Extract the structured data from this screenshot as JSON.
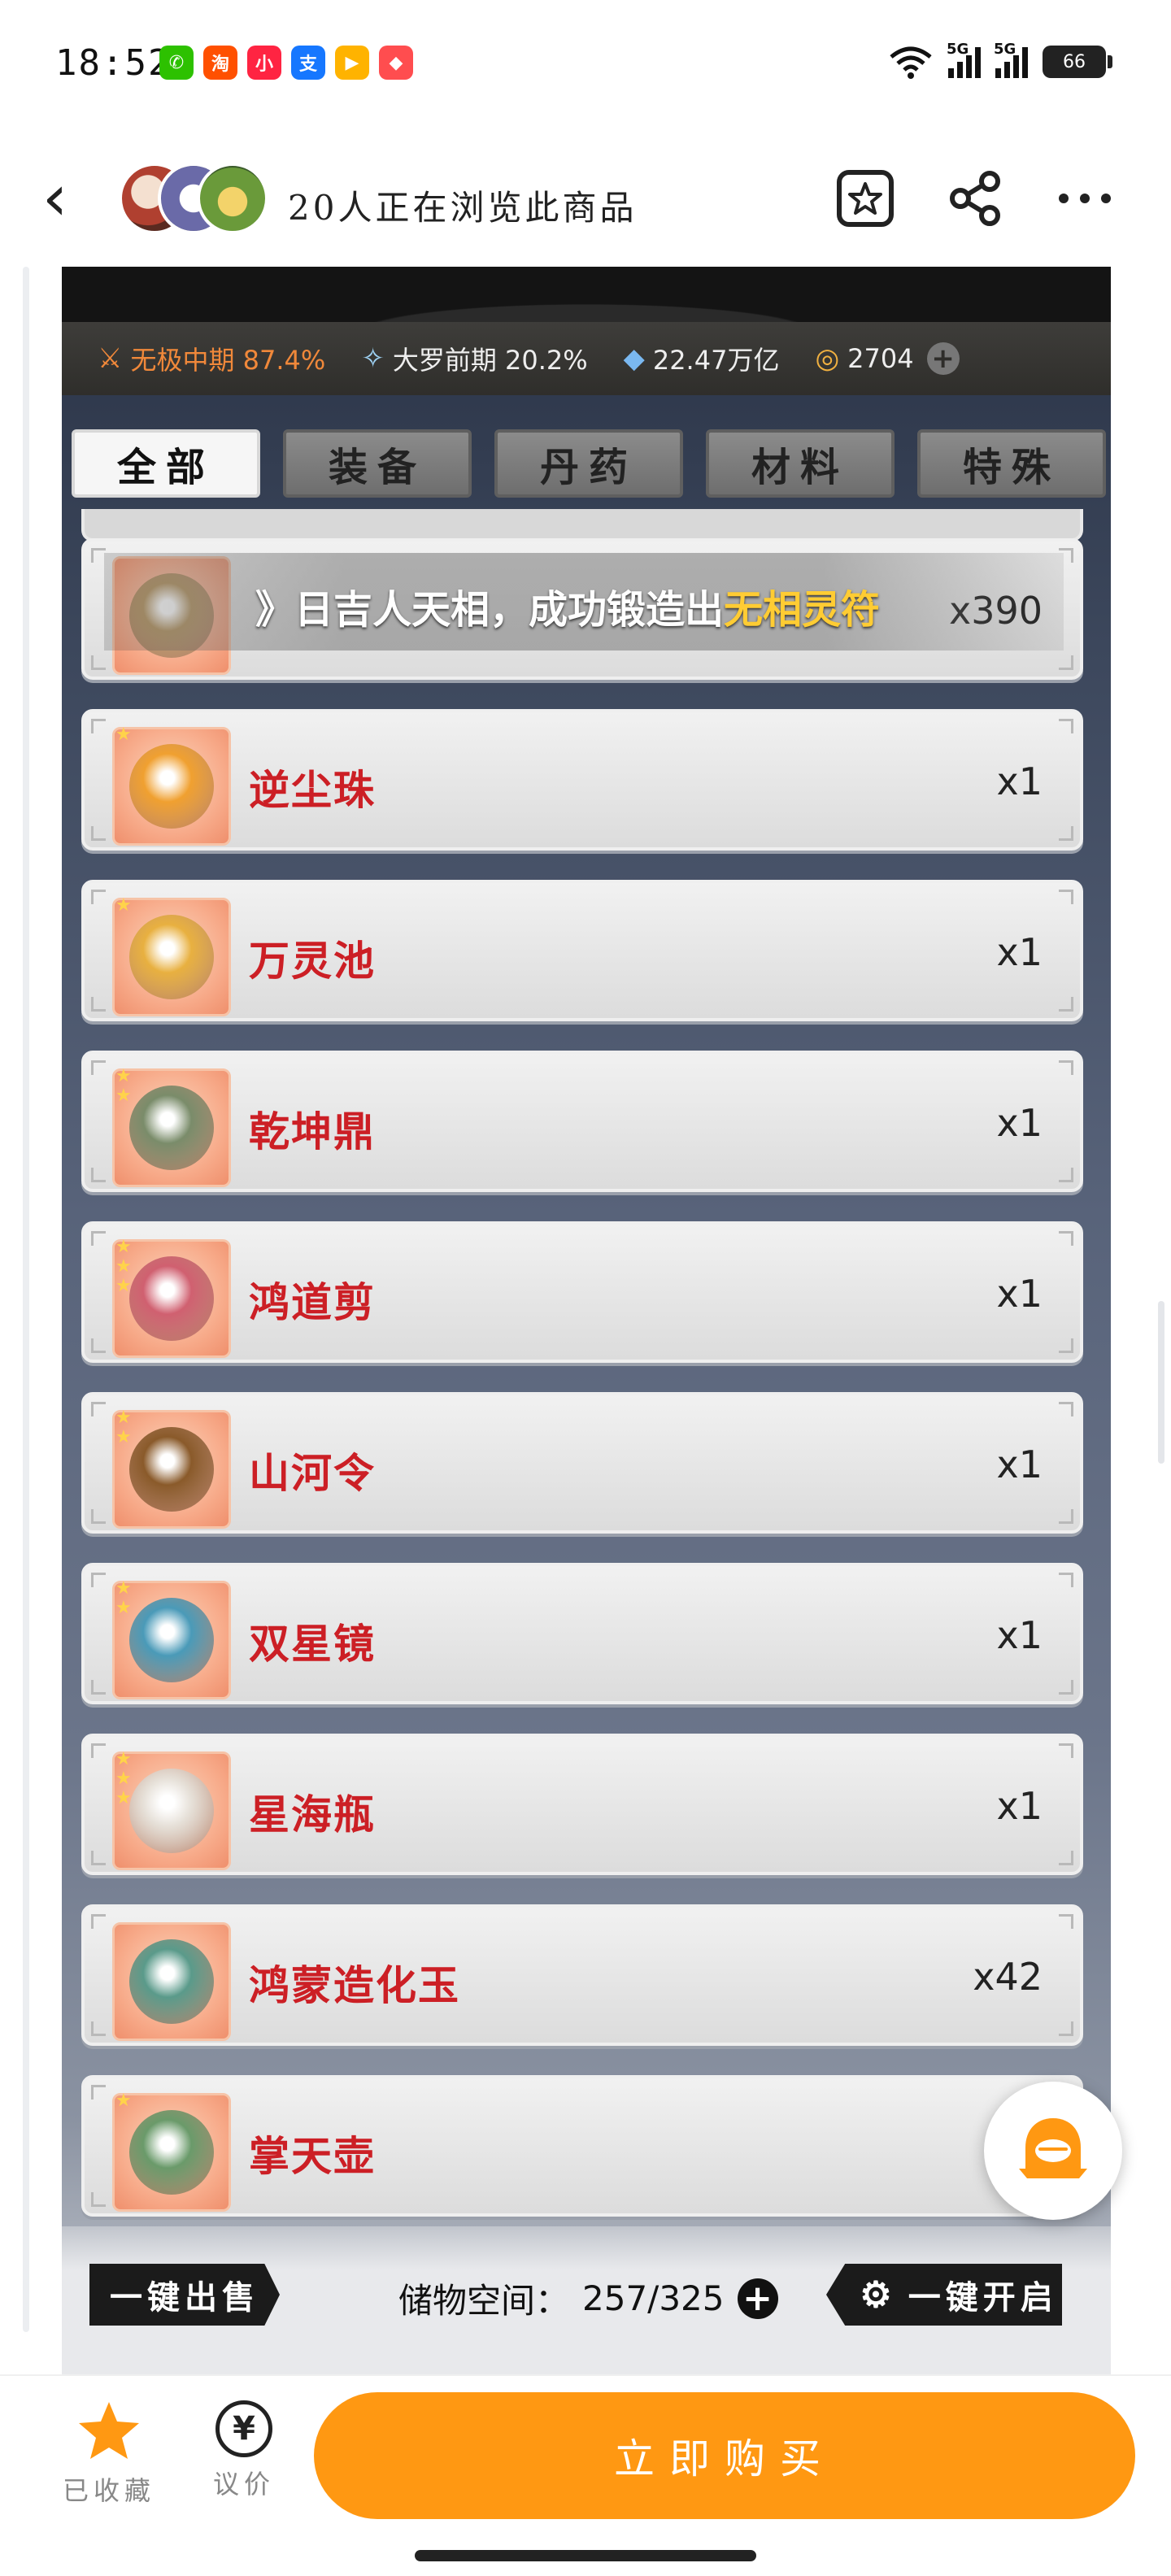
{
  "status_bar": {
    "time": "18:52",
    "apps": [
      {
        "icon": "wechat-icon",
        "color": "#2dc100",
        "glyph": "✆"
      },
      {
        "icon": "taobao-icon",
        "color": "#ff5000",
        "glyph": "淘"
      },
      {
        "icon": "xiaohongshu-icon",
        "color": "#ff2442",
        "glyph": "小"
      },
      {
        "icon": "alipay-icon",
        "color": "#1677ff",
        "glyph": "支"
      },
      {
        "icon": "video-icon",
        "color": "#ffb300",
        "glyph": "▶"
      },
      {
        "icon": "game-icon",
        "color": "#ff4d4f",
        "glyph": "◆"
      }
    ],
    "signal1": "5G",
    "signal2": "5G",
    "battery": "66"
  },
  "nav": {
    "title": "20人正在浏览此商品"
  },
  "game": {
    "stats": [
      {
        "icon": "sword-icon",
        "text": "无极中期 87.4%",
        "orange": true
      },
      {
        "icon": "fan-icon",
        "text": "大罗前期 20.2%",
        "orange": false
      },
      {
        "icon": "water-drop-icon",
        "text": "22.47万亿",
        "orange": false
      },
      {
        "icon": "coin-icon",
        "text": "2704",
        "orange": false
      }
    ],
    "tabs": [
      "全部",
      "装备",
      "丹药",
      "材料",
      "特殊"
    ],
    "active_tab": 0,
    "ticker": {
      "prefix": "》日吉人天相，成功锻造出",
      "highlight": "无相灵符"
    },
    "items": [
      {
        "name": "",
        "qty": "x390",
        "stars": 0,
        "art": "#b89a6a"
      },
      {
        "name": "逆尘珠",
        "qty": "x1",
        "stars": 1,
        "art": "#f0a030"
      },
      {
        "name": "万灵池",
        "qty": "x1",
        "stars": 1,
        "art": "#e8b040"
      },
      {
        "name": "乾坤鼎",
        "qty": "x1",
        "stars": 2,
        "art": "#7a8c6a"
      },
      {
        "name": "鸿道剪",
        "qty": "x1",
        "stars": 3,
        "art": "#d06070"
      },
      {
        "name": "山河令",
        "qty": "x1",
        "stars": 2,
        "art": "#8a5a2a"
      },
      {
        "name": "双星镜",
        "qty": "x1",
        "stars": 2,
        "art": "#4a9ab8"
      },
      {
        "name": "星海瓶",
        "qty": "x1",
        "stars": 3,
        "art": "#e6e0d8"
      },
      {
        "name": "鸿蒙造化玉",
        "qty": "x42",
        "stars": 0,
        "art": "#5a9a8a"
      },
      {
        "name": "掌天壶",
        "qty": "",
        "stars": 1,
        "art": "#6a9a6a"
      }
    ],
    "sell_all_label": "一键出售",
    "storage_label": "储物空间：",
    "storage_value": "257/325",
    "open_all_label": "一键开启"
  },
  "buy_bar": {
    "favorite_label": "已收藏",
    "bargain_label": "议价",
    "bargain_glyph": "¥",
    "buy_label": "立即购买"
  },
  "colors": {
    "accent": "#ff9812",
    "item_name": "#cc1f25",
    "ticker_highlight": "#ffcc33"
  }
}
